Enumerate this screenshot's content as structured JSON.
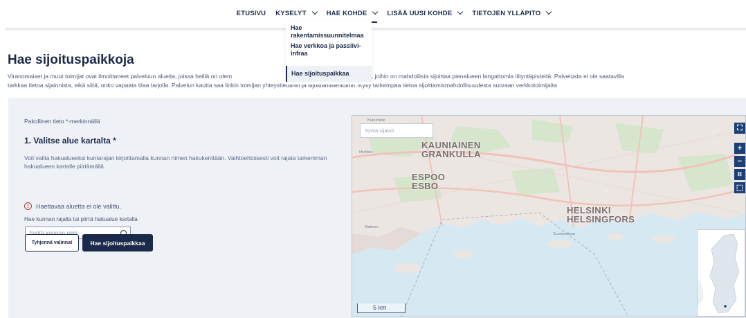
{
  "nav": {
    "items": [
      {
        "label": "ETUSIVU",
        "dropdown": false,
        "active": false
      },
      {
        "label": "KYSELYT",
        "dropdown": true,
        "active": false
      },
      {
        "label": "HAE KOHDE",
        "dropdown": true,
        "active": true
      },
      {
        "label": "LISÄÄ UUSI KOHDE",
        "dropdown": true,
        "active": false
      },
      {
        "label": "TIETOJEN YLLÄPITO",
        "dropdown": true,
        "active": false
      }
    ]
  },
  "dropdown": {
    "items": [
      "Hae rakentamissuunnitelmaa",
      "Hae verkkoa ja passiivi-infraa",
      "Hae sijoituspaikkaa"
    ]
  },
  "page": {
    "title": "Hae sijoituspaikkoja",
    "intro_line1": "Viranomaiset ja muut toimijat ovat ilmoittaneet palveluun alueita, joissa heillä on olem                                                    a ja muita rakenteita, joihin on mahdollista sijoittaa pienalueen langattomia liityntäpisteitä. Palvelusta ei ole saatavilla",
    "intro_line2": "tarkkaa tietoa sijainnista, eikä siitä, onko vapaata tilaa tarjolla. Palvelun kautta saa linkin toimijan yhteystietoihin ja sijoittamisehtoihin. Kysy tarkempaa tietoa sijoittamismahdollisuudesta suoraan verkkotoimijalta"
  },
  "form": {
    "required_note": "Pakollinen tieto *-merkinnällä",
    "section_title": "1. Valitse alue kartalta *",
    "section_text": "Voit valita hakualueeksi kuntarajan kirjoittamalla kunnan nimen hakukenttään. Vaihtoehtoisesti voit rajata tarkemman hakualueen kartalle piirtämällä.",
    "error_text": "Haettavaa aluetta ei ole valittu.",
    "field_label": "Hae kunnan rajalla tai piirrä hakualue kartalla",
    "field_placeholder": "Syötä kunnan nimi",
    "clear_button": "Tyhjennä valinnat",
    "search_button": "Hae sijoituspaikkaa"
  },
  "map": {
    "search_placeholder": "Syötä sijainti",
    "labels": {
      "kauniainen": "KAUNIAINEN",
      "grankulla": "GRANKULLA",
      "espoo": "ESPOO",
      "esbo": "ESBO",
      "helsinki": "HELSINKI",
      "helsingfors": "HELSINGFORS",
      "nupurböle": "Nupurböle",
      "myrbble": "Myrbble",
      "malmen": "Malmen",
      "suomenlinna": "Suomenlinna"
    },
    "scale_label": "5 km",
    "controls": [
      "fullscreen-icon",
      "zoom-in-icon",
      "zoom-out-icon",
      "draw-area-icon",
      "draw-freehand-icon"
    ]
  },
  "colors": {
    "brand": "#1b2a4a",
    "map_button": "#1b3f76",
    "error": "#c0392b",
    "panel": "#eef1f6"
  }
}
